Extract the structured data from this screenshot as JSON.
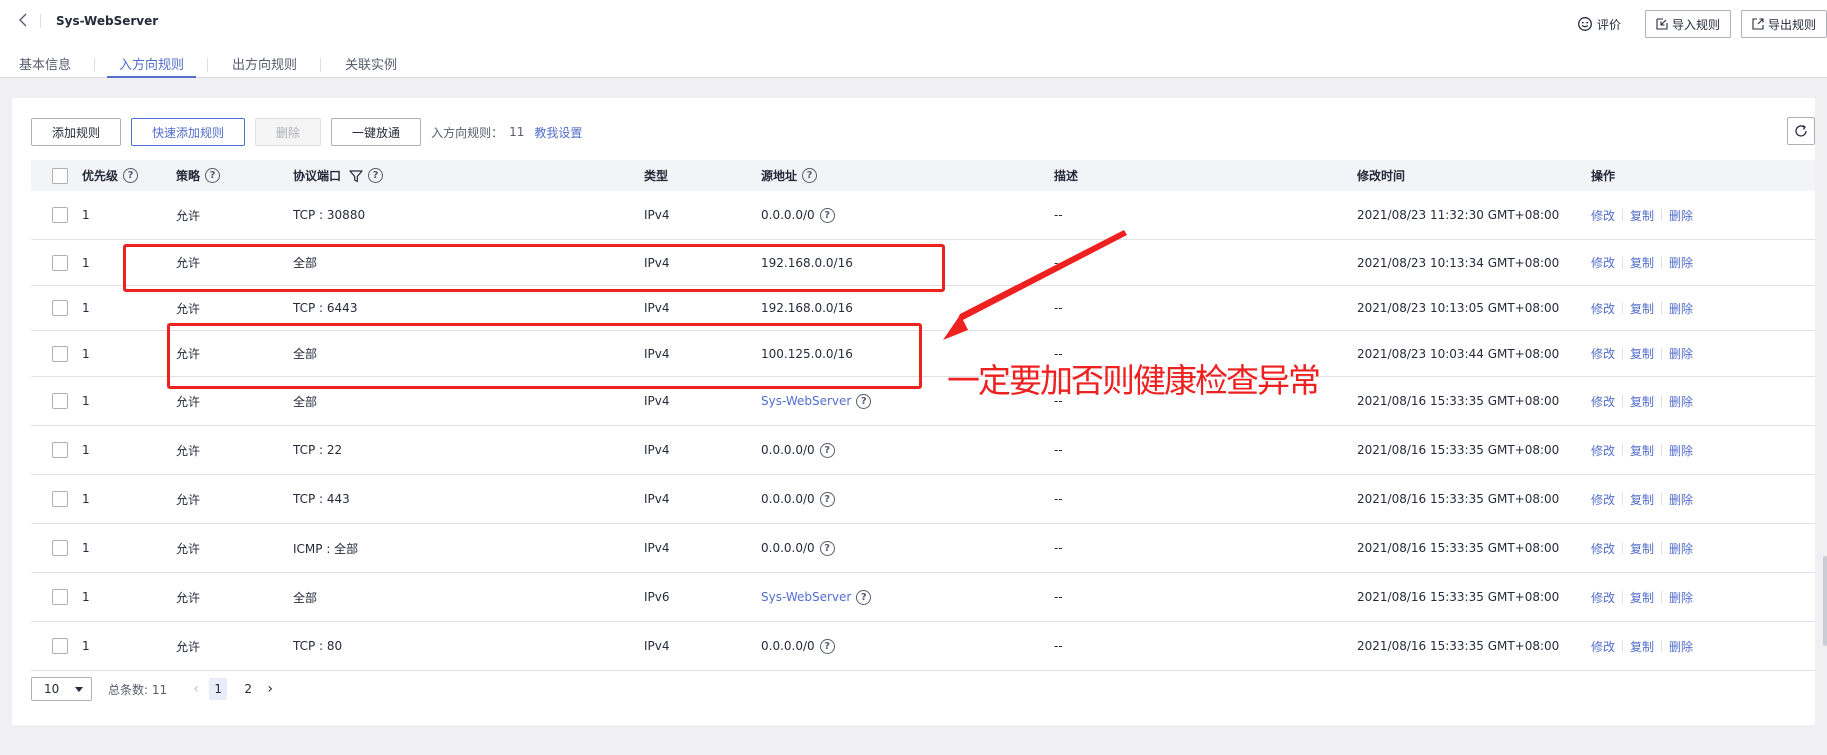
{
  "header": {
    "title": "Sys-WebServer",
    "feedback_label": "评价",
    "import_label": "导入规则",
    "export_label": "导出规则"
  },
  "tabs": [
    {
      "label": "基本信息",
      "active": false
    },
    {
      "label": "入方向规则",
      "active": true
    },
    {
      "label": "出方向规则",
      "active": false
    },
    {
      "label": "关联实例",
      "active": false
    }
  ],
  "toolbar": {
    "add_label": "添加规则",
    "quick_add_label": "快速添加规则",
    "delete_label": "删除",
    "allow_all_label": "一键放通",
    "rule_count_label": "入方向规则：",
    "rule_count": "11",
    "help_link": "教我设置"
  },
  "columns": {
    "priority": "优先级",
    "policy": "策略",
    "protocol": "协议端口",
    "type": "类型",
    "source": "源地址",
    "description": "描述",
    "modified": "修改时间",
    "ops": "操作"
  },
  "ops_labels": {
    "edit": "修改",
    "copy": "复制",
    "delete": "删除"
  },
  "rows": [
    {
      "priority": "1",
      "policy": "允许",
      "protocol": "TCP : 30880",
      "type": "IPv4",
      "source": "0.0.0.0/0",
      "source_link": false,
      "source_help": true,
      "description": "--",
      "modified": "2021/08/23 11:32:30 GMT+08:00"
    },
    {
      "priority": "1",
      "policy": "允许",
      "protocol": "全部",
      "type": "IPv4",
      "source": "192.168.0.0/16",
      "source_link": false,
      "source_help": false,
      "description": "--",
      "modified": "2021/08/23 10:13:34 GMT+08:00"
    },
    {
      "priority": "1",
      "policy": "允许",
      "protocol": "TCP : 6443",
      "type": "IPv4",
      "source": "192.168.0.0/16",
      "source_link": false,
      "source_help": false,
      "description": "--",
      "modified": "2021/08/23 10:13:05 GMT+08:00"
    },
    {
      "priority": "1",
      "policy": "允许",
      "protocol": "全部",
      "type": "IPv4",
      "source": "100.125.0.0/16",
      "source_link": false,
      "source_help": false,
      "description": "--",
      "modified": "2021/08/23 10:03:44 GMT+08:00"
    },
    {
      "priority": "1",
      "policy": "允许",
      "protocol": "全部",
      "type": "IPv4",
      "source": "Sys-WebServer",
      "source_link": true,
      "source_help": true,
      "description": "--",
      "modified": "2021/08/16 15:33:35 GMT+08:00"
    },
    {
      "priority": "1",
      "policy": "允许",
      "protocol": "TCP : 22",
      "type": "IPv4",
      "source": "0.0.0.0/0",
      "source_link": false,
      "source_help": true,
      "description": "--",
      "modified": "2021/08/16 15:33:35 GMT+08:00"
    },
    {
      "priority": "1",
      "policy": "允许",
      "protocol": "TCP : 443",
      "type": "IPv4",
      "source": "0.0.0.0/0",
      "source_link": false,
      "source_help": true,
      "description": "--",
      "modified": "2021/08/16 15:33:35 GMT+08:00"
    },
    {
      "priority": "1",
      "policy": "允许",
      "protocol": "ICMP : 全部",
      "type": "IPv4",
      "source": "0.0.0.0/0",
      "source_link": false,
      "source_help": true,
      "description": "--",
      "modified": "2021/08/16 15:33:35 GMT+08:00"
    },
    {
      "priority": "1",
      "policy": "允许",
      "protocol": "全部",
      "type": "IPv6",
      "source": "Sys-WebServer",
      "source_link": true,
      "source_help": true,
      "description": "--",
      "modified": "2021/08/16 15:33:35 GMT+08:00"
    },
    {
      "priority": "1",
      "policy": "允许",
      "protocol": "TCP : 80",
      "type": "IPv4",
      "source": "0.0.0.0/0",
      "source_link": false,
      "source_help": true,
      "description": "--",
      "modified": "2021/08/16 15:33:35 GMT+08:00"
    }
  ],
  "pagination": {
    "page_size": "10",
    "total_label": "总条数: 11",
    "pages": [
      "1",
      "2"
    ],
    "current": "1"
  },
  "annotation": {
    "text": "一定要加否则健康检查异常",
    "color": "#ee2121"
  },
  "colors": {
    "accent": "#526ecc",
    "text": "#252b3a",
    "annotation": "#ee2121"
  }
}
